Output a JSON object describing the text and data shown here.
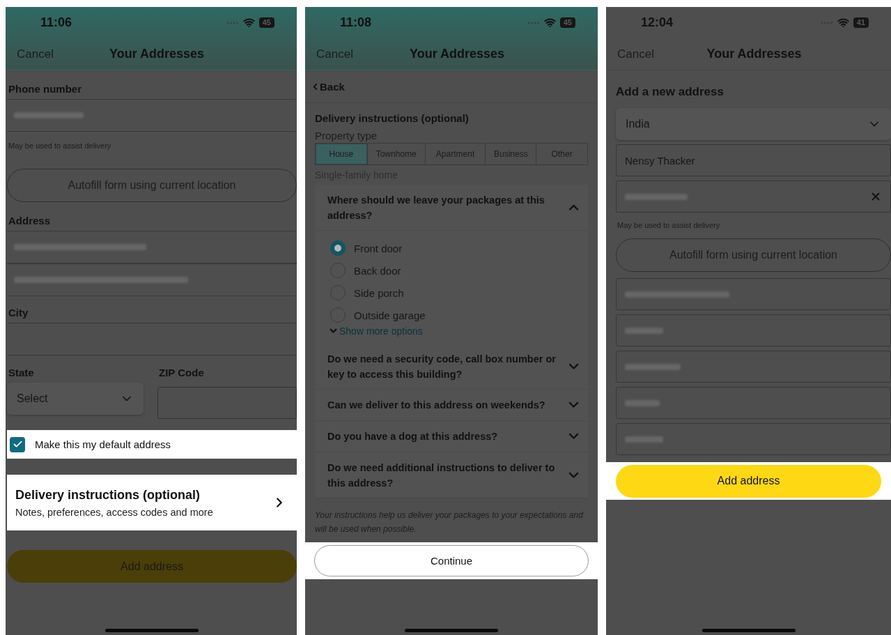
{
  "screens": [
    {
      "kind": "address_form",
      "status_bar": {
        "time": "11:06",
        "battery": "45"
      },
      "nav": {
        "cancel": "Cancel",
        "title": "Your Addresses"
      },
      "phone": {
        "label": "Phone number",
        "hint": "May be used to assist delivery"
      },
      "autofill_button": "Autofill form using current location",
      "address": {
        "label": "Address"
      },
      "city": {
        "label": "City"
      },
      "state": {
        "label": "State",
        "value": "Select"
      },
      "zip": {
        "label": "ZIP Code"
      },
      "default_checkbox": {
        "label": "Make this my default address",
        "checked": true,
        "highlighted": true
      },
      "delivery_row": {
        "title": "Delivery instructions (optional)",
        "subtitle": "Notes, preferences, access codes and more",
        "highlighted": true
      },
      "submit_button": {
        "label": "Add address",
        "highlighted": false
      }
    },
    {
      "kind": "delivery_instructions",
      "status_bar": {
        "time": "11:08",
        "battery": "45"
      },
      "nav": {
        "cancel": "Cancel",
        "title": "Your Addresses"
      },
      "back": "Back",
      "title": "Delivery instructions (optional)",
      "property_type": {
        "label": "Property type",
        "description": "Single-family home",
        "options": [
          {
            "label": "House",
            "selected": true
          },
          {
            "label": "Townhome",
            "selected": false
          },
          {
            "label": "Apartment",
            "selected": false
          },
          {
            "label": "Business",
            "selected": false
          },
          {
            "label": "Other",
            "selected": false
          }
        ]
      },
      "questions": [
        {
          "text": "Where should we leave your packages at this address?",
          "expanded": true,
          "more": "Show more options",
          "options": [
            {
              "label": "Front door",
              "selected": true
            },
            {
              "label": "Back door",
              "selected": false
            },
            {
              "label": "Side porch",
              "selected": false
            },
            {
              "label": "Outside garage",
              "selected": false
            }
          ]
        },
        {
          "text": "Do we need a security code, call box number or key to access this building?",
          "expanded": false
        },
        {
          "text": "Can we deliver to this address on weekends?",
          "expanded": false
        },
        {
          "text": "Do you have a dog at this address?",
          "expanded": false
        },
        {
          "text": "Do we need additional instructions to deliver to this address?",
          "expanded": false
        }
      ],
      "note": "Your instructions help us deliver your packages to your expectations and will be used when possible.",
      "continue_button": {
        "label": "Continue",
        "highlighted": true
      }
    },
    {
      "kind": "new_address",
      "status_bar": {
        "time": "12:04",
        "battery": "41"
      },
      "nav": {
        "cancel": "Cancel",
        "title": "Your Addresses"
      },
      "heading": "Add a new address",
      "country": "India",
      "name": "Nensy Thacker",
      "phone_hint": "May be used to assist delivery",
      "autofill_button": "Autofill form using current location",
      "submit_button": {
        "label": "Add address",
        "highlighted": true
      }
    }
  ]
}
